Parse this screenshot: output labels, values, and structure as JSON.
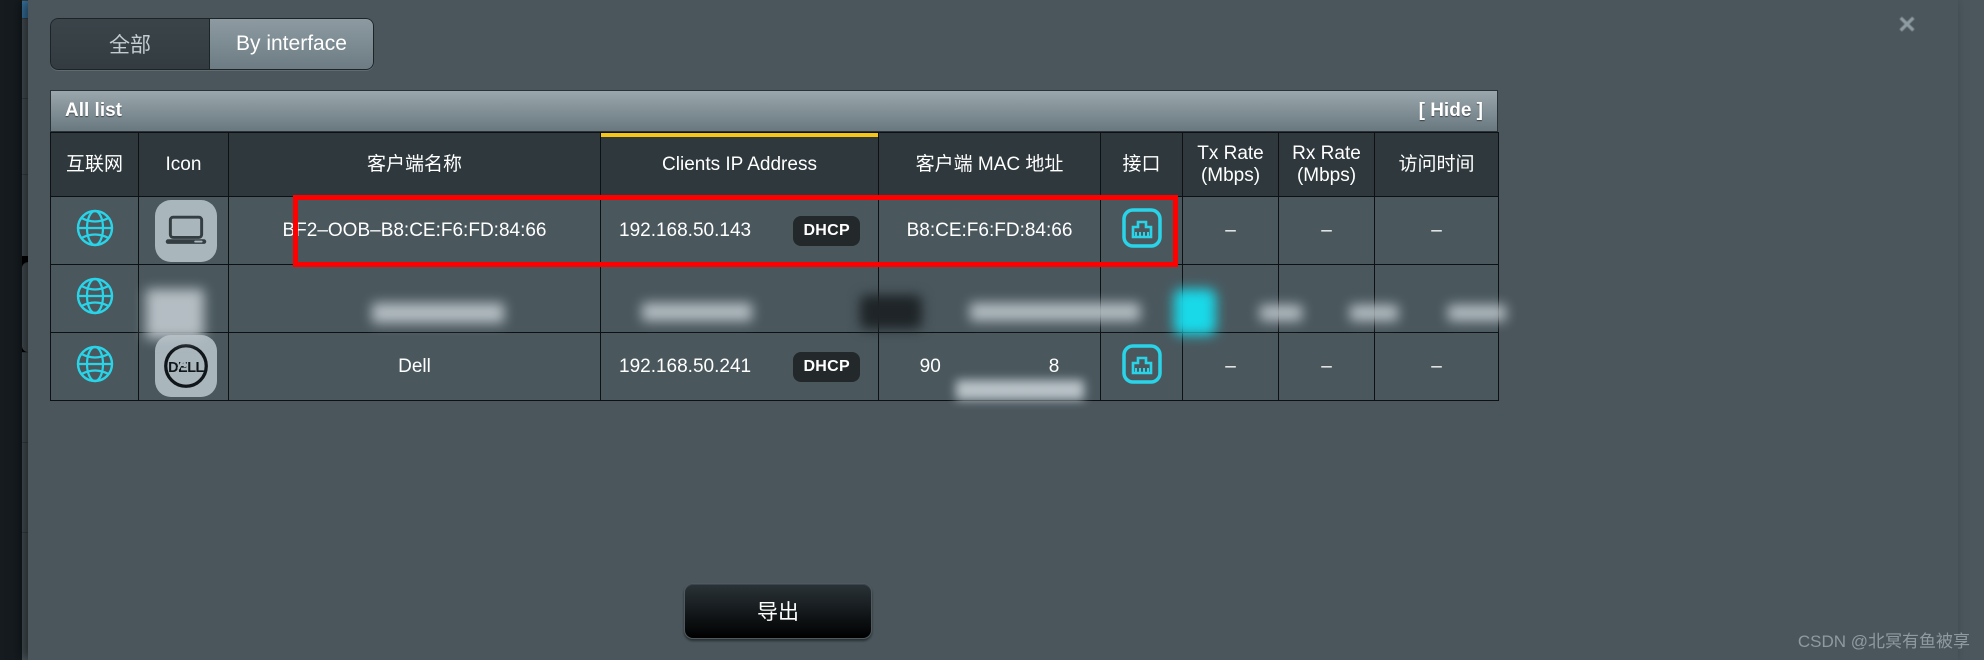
{
  "window": {
    "close_label": "×"
  },
  "tabs": [
    {
      "label": "全部",
      "selected": true
    },
    {
      "label": "By interface",
      "selected": false
    }
  ],
  "panel": {
    "title": "All list",
    "hide_label": "[ Hide ]"
  },
  "table": {
    "accent_color": "#f5c518",
    "columns": [
      {
        "label": "互联网",
        "accent": false
      },
      {
        "label": "Icon",
        "accent": false
      },
      {
        "label": "客户端名称",
        "accent": false
      },
      {
        "label": "Clients IP Address",
        "accent": true
      },
      {
        "label": "客户端 MAC 地址",
        "accent": false
      },
      {
        "label": "接口",
        "accent": false
      },
      {
        "label": "Tx Rate\n(Mbps)",
        "accent": false
      },
      {
        "label": "Rx Rate\n(Mbps)",
        "accent": false
      },
      {
        "label": "访问时间",
        "accent": false
      }
    ],
    "column_labels_multiline": {
      "tx_line1": "Tx Rate",
      "tx_line2": "(Mbps)",
      "rx_line1": "Rx Rate",
      "rx_line2": "(Mbps)"
    },
    "rows": [
      {
        "internet_icon": "globe-icon",
        "device_icon": "laptop-icon",
        "client_name": "BF2–OOB–B8:CE:F6:FD:84:66",
        "ip": "192.168.50.143",
        "ip_badge": "DHCP",
        "mac": "B8:CE:F6:FD:84:66",
        "interface_icon": "ethernet-port-icon",
        "tx_rate": "–",
        "rx_rate": "–",
        "access_time": "–",
        "highlighted": true,
        "blurred": false
      },
      {
        "internet_icon": "globe-icon",
        "device_icon": "device-icon",
        "client_name": "",
        "ip": "",
        "ip_badge": "",
        "mac": "",
        "interface_icon": "wifi-icon",
        "tx_rate": "",
        "rx_rate": "",
        "access_time": "",
        "highlighted": false,
        "blurred": true
      },
      {
        "internet_icon": "globe-icon",
        "device_icon": "dell-logo-icon",
        "client_name": "Dell",
        "ip": "192.168.50.241",
        "ip_badge": "DHCP",
        "mac": "90",
        "mac_suffix": "8",
        "mac_blurred": true,
        "interface_icon": "ethernet-port-icon",
        "tx_rate": "–",
        "rx_rate": "–",
        "access_time": "–",
        "highlighted": false,
        "blurred": false
      }
    ]
  },
  "footer": {
    "export_label": "导出"
  },
  "watermark": {
    "text": "CSDN @北冥有鱼被享"
  },
  "colors": {
    "accent_yellow": "#f5c518",
    "highlight_red": "#ff0000",
    "icon_cyan": "#2ad4e8",
    "panel_bg": "#4a585c",
    "header_bg": "#2e383d"
  }
}
